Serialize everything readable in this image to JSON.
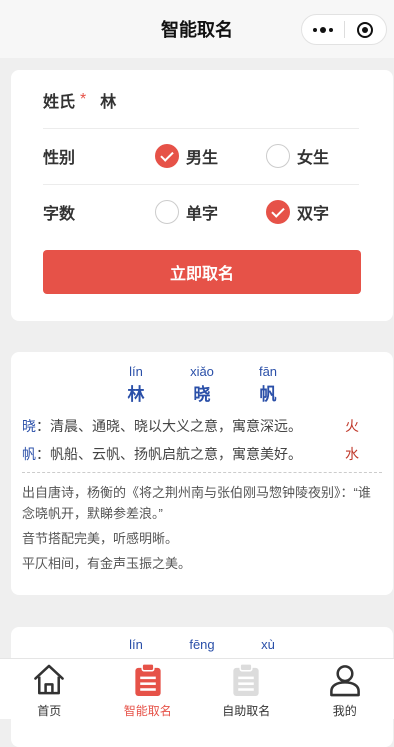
{
  "header": {
    "title": "智能取名"
  },
  "form": {
    "surname_label": "姓氏",
    "required_mark": "*",
    "surname_value": "林",
    "gender_label": "性别",
    "gender_options": [
      {
        "label": "男生",
        "checked": true
      },
      {
        "label": "女生",
        "checked": false
      }
    ],
    "count_label": "字数",
    "count_options": [
      {
        "label": "单字",
        "checked": false
      },
      {
        "label": "双字",
        "checked": true
      }
    ],
    "submit_label": "立即取名"
  },
  "results": [
    {
      "chars": [
        {
          "pinyin": "lín",
          "hanzi": "林"
        },
        {
          "pinyin": "xiǎo",
          "hanzi": "晓"
        },
        {
          "pinyin": "fān",
          "hanzi": "帆"
        }
      ],
      "meanings": [
        {
          "char": "晓",
          "text": "：清晨、通晓、晓以大义之意，寓意深远。",
          "element": "火"
        },
        {
          "char": "帆",
          "text": "：帆船、云帆、扬帆启航之意，寓意美好。",
          "element": "水"
        }
      ],
      "source": "出自唐诗，杨衡的《将之荆州南与张伯刚马惣钟陵夜别》：“谁念晓帆开，默睇参差浪。”",
      "tone_note": "音节搭配完美，听感明晰。",
      "rhythm_note": "平仄相间，有金声玉振之美。"
    },
    {
      "chars": [
        {
          "pinyin": "lín",
          "hanzi": ""
        },
        {
          "pinyin": "fēng",
          "hanzi": ""
        },
        {
          "pinyin": "xù",
          "hanzi": ""
        }
      ]
    }
  ],
  "tabbar": {
    "active_color": "#e65248",
    "items": [
      {
        "label": "首页",
        "icon": "home-icon"
      },
      {
        "label": "智能取名",
        "icon": "clipboard-icon",
        "active": true
      },
      {
        "label": "自助取名",
        "icon": "clipboard-icon"
      },
      {
        "label": "我的",
        "icon": "user-icon"
      }
    ]
  }
}
